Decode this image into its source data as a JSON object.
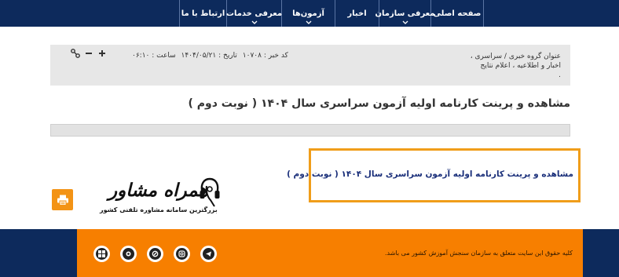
{
  "nav": {
    "items": [
      {
        "label": "صفحه اصلی",
        "chevron": false
      },
      {
        "label": "معرفی سازمان",
        "chevron": true
      },
      {
        "label": "اخبار",
        "chevron": false
      },
      {
        "label": "آزمون‌ها",
        "chevron": true
      },
      {
        "label": "معرفی خدمات",
        "chevron": true
      },
      {
        "label": "ارتباط با ما",
        "chevron": false
      }
    ]
  },
  "meta": {
    "news_group_line1": "عنوان گروه خبری / سراسری ،",
    "news_group_line2": "اخبار و اطلاعیه ، اعلام نتایج",
    "news_group_line3": ".",
    "news_code": "کد خبر : ۱۰۷۰۸",
    "date": "تاریخ : ۱۴۰۴/۰۵/۲۱",
    "time": "ساعت : ۰۶:۱۰"
  },
  "page_title": "مشاهده و پرینت کارنامه اولیه آزمون سراسری سال ۱۴۰۴ ( نوبت دوم )",
  "link_text": "مشاهده و پرینت کارنامه اولیه آزمون سراسری سال ۱۴۰۴ ( نوبت دوم )",
  "logo": {
    "name": "همراه مشاور",
    "tagline": "بزرگترین سامانه مشاوره تلفنی کشور"
  },
  "footer": {
    "copyright": "کلیه حقوق این سایت متعلق به سازمان سنجش آموزش کشور می باشد."
  },
  "colors": {
    "nav_bg": "#0d2a5c",
    "footer_bg": "#f77f00",
    "accent_border": "#f09d1a",
    "link": "#1a2f7a"
  }
}
